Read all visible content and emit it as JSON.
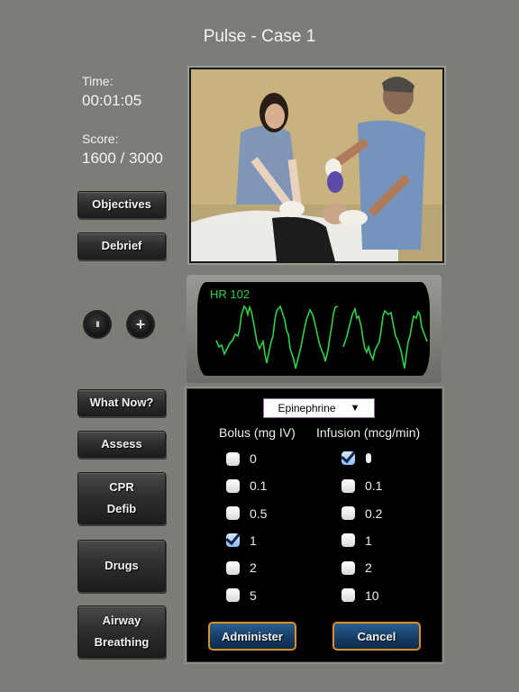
{
  "header": {
    "title": "Pulse - Case 1"
  },
  "stats": {
    "time_label": "Time:",
    "time_value": "00:01:05",
    "score_label": "Score:",
    "score_value": "1600 / 3000"
  },
  "top_buttons": {
    "objectives": "Objectives",
    "debrief": "Debrief"
  },
  "controls": {
    "pause_icon": "pause-icon",
    "add_icon": "plus-icon",
    "pause_glyph": "II",
    "add_glyph": "+"
  },
  "monitor": {
    "hr_label": "HR 102",
    "trace_color": "#2fd14a"
  },
  "action_buttons": {
    "what_now": "What Now?",
    "assess": "Assess",
    "cpr_line1": "CPR",
    "cpr_line2": "Defib",
    "drugs": "Drugs",
    "airway_line1": "Airway",
    "airway_line2": "Breathing"
  },
  "drug_panel": {
    "selected_drug": "Epinephrine",
    "dropdown_arrow": "▼",
    "bolus_header": "Bolus (mg IV)",
    "infusion_header": "Infusion (mcg/min)",
    "bolus_options": [
      {
        "label": "0",
        "checked": false
      },
      {
        "label": "0.1",
        "checked": false
      },
      {
        "label": "0.5",
        "checked": false
      },
      {
        "label": "1",
        "checked": true
      },
      {
        "label": "2",
        "checked": false
      },
      {
        "label": "5",
        "checked": false
      }
    ],
    "infusion_options": [
      {
        "label": "0",
        "checked": true
      },
      {
        "label": "0.1",
        "checked": false
      },
      {
        "label": "0.2",
        "checked": false
      },
      {
        "label": "1",
        "checked": false
      },
      {
        "label": "2",
        "checked": false
      },
      {
        "label": "10",
        "checked": false
      }
    ],
    "administer_label": "Administer",
    "cancel_label": "Cancel",
    "button_border_color": "#d9902a"
  }
}
